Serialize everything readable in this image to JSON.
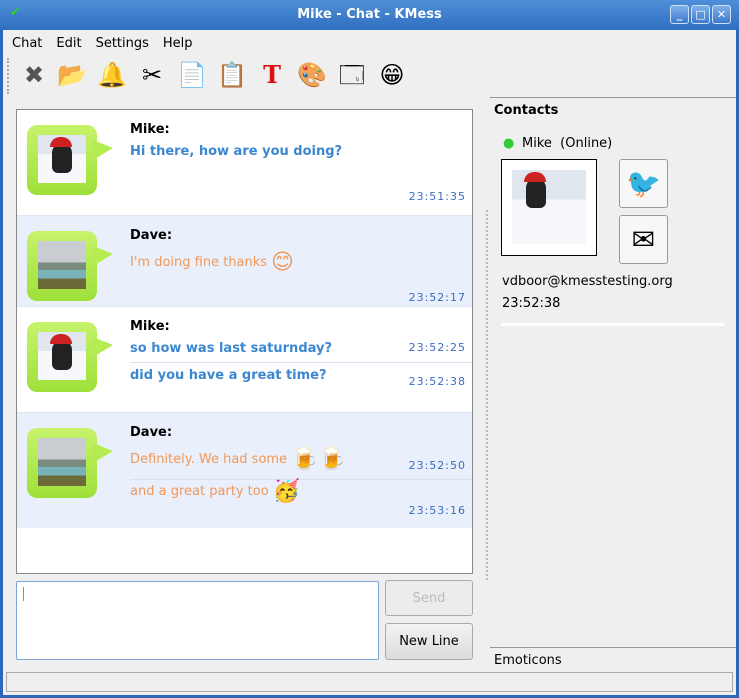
{
  "window": {
    "title": "Mike - Chat - KMess"
  },
  "menu": [
    "Chat",
    "Edit",
    "Settings",
    "Help"
  ],
  "toolbar": [
    {
      "icon": "close-icon",
      "glyph": "✖"
    },
    {
      "icon": "folder-icon",
      "glyph": "📂"
    },
    {
      "icon": "bell-icon",
      "glyph": "🔔"
    },
    {
      "icon": "scissors-icon",
      "glyph": "✂"
    },
    {
      "icon": "copy-icon",
      "glyph": "📄"
    },
    {
      "icon": "paste-icon",
      "glyph": "📋"
    },
    {
      "icon": "font-icon",
      "glyph": "T"
    },
    {
      "icon": "palette-icon",
      "glyph": "🎨"
    },
    {
      "icon": "window-new-icon",
      "glyph": "🗔"
    },
    {
      "icon": "emoticon-icon",
      "glyph": "😁"
    }
  ],
  "messages": [
    {
      "sender": "Mike:",
      "lines": [
        {
          "text": "Hi there, how are you doing?",
          "time": "23:51:35"
        }
      ]
    },
    {
      "sender": "Dave:",
      "lines": [
        {
          "text": "I'm doing fine thanks",
          "time": "23:52:17",
          "emoticon": "😊"
        }
      ]
    },
    {
      "sender": "Mike:",
      "lines": [
        {
          "text": "so how was last saturnday?",
          "time": "23:52:25"
        },
        {
          "text": "did you have a great time?",
          "time": "23:52:38"
        }
      ]
    },
    {
      "sender": "Dave:",
      "lines": [
        {
          "text": "Definitely. We had some",
          "time": "23:52:50",
          "emoticon": "🍺🍺"
        },
        {
          "text": "and a great party too",
          "time": "23:53:16",
          "emoticon": "🥳"
        }
      ]
    }
  ],
  "input": {
    "value": ""
  },
  "buttons": {
    "send": "Send",
    "newline": "New Line"
  },
  "contacts": {
    "tab": "Contacts",
    "name": "Mike",
    "status": "(Online)",
    "email": "vdboor@kmesstesting.org",
    "time": "23:52:38"
  },
  "emoticons_tab": "Emoticons",
  "colors": {
    "mike_text": "#3b87d1",
    "dave_text": "#f0985a",
    "timestamp": "#3a6cc0",
    "title_bar": "#3a7cc8"
  }
}
